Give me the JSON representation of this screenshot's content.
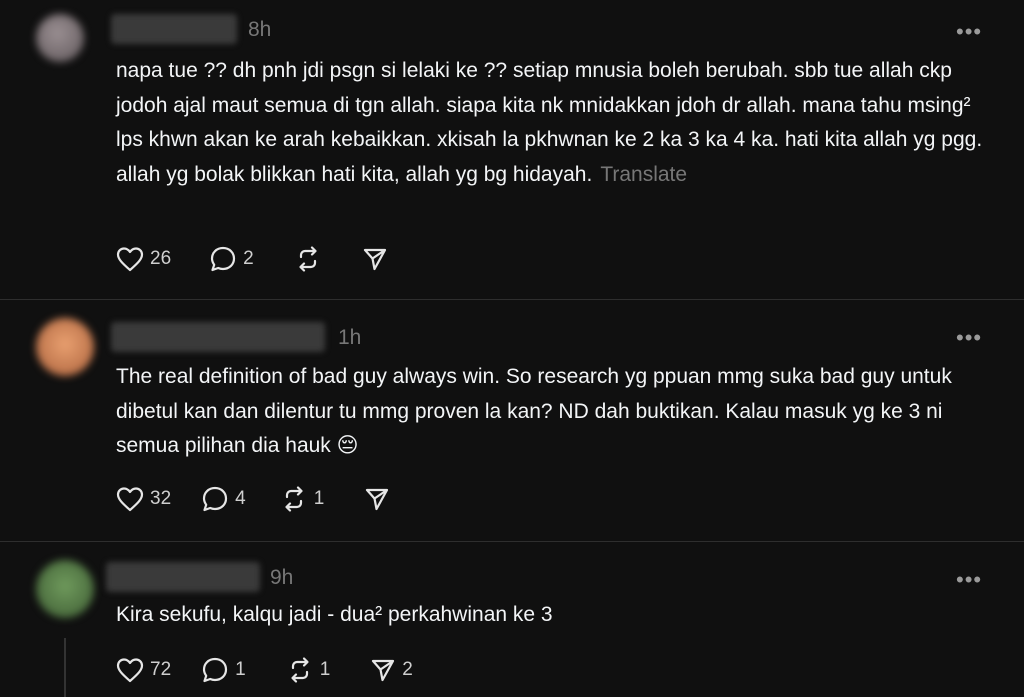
{
  "posts": [
    {
      "time": "8h",
      "text": "napa tue ?? dh pnh jdi psgn si lelaki ke ?? setiap mnusia boleh berubah. sbb tue allah ckp jodoh ajal maut semua di tgn allah. siapa kita nk mnidakkan jdoh dr allah. mana tahu msing² lps khwn akan ke arah kebaikkan. xkisah la pkhwnan ke 2 ka 3 ka 4 ka. hati kita allah yg pgg. allah yg bolak blikkan hati kita, allah yg bg hidayah.",
      "translate": "Translate",
      "likes": "26",
      "replies": "2",
      "reposts": "",
      "shares": "",
      "more": "•••"
    },
    {
      "time": "1h",
      "text": "The real definition of bad guy always win. So research yg ppuan mmg suka bad guy untuk dibetul kan dan dilentur tu mmg proven la kan? ND dah buktikan. Kalau masuk yg ke 3 ni semua pilihan dia hauk 😔",
      "translate": "",
      "likes": "32",
      "replies": "4",
      "reposts": "1",
      "shares": "",
      "more": "•••"
    },
    {
      "time": "9h",
      "text": "Kira sekufu, kalqu jadi - dua² perkahwinan ke 3",
      "translate": "",
      "likes": "72",
      "replies": "1",
      "reposts": "1",
      "shares": "2",
      "more": "•••"
    }
  ],
  "icons": {
    "like": "heart-icon",
    "reply": "comment-bubble-icon",
    "repost": "repost-arrows-icon",
    "share": "send-icon",
    "more": "more-dots-icon"
  },
  "colors": {
    "background": "#101010",
    "text": "#f3f5f7",
    "muted": "#777777",
    "divider": "#2e2e2e"
  }
}
